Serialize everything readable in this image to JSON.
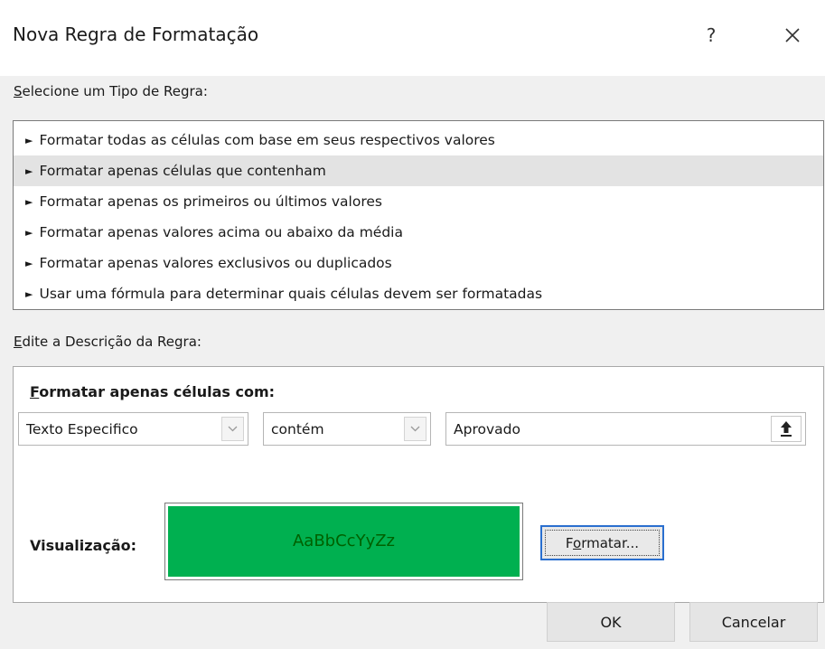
{
  "dialog": {
    "title": "Nova Regra de Formatação",
    "help_label": "?",
    "close_icon": "close-icon"
  },
  "rule_type": {
    "label_access_key": "S",
    "label_rest": "elecione um Tipo de Regra:",
    "selected_index": 1,
    "items": [
      "Formatar todas as células com base em seus respectivos valores",
      "Formatar apenas células que contenham",
      "Formatar apenas os primeiros ou últimos valores",
      "Formatar apenas valores acima ou abaixo da média",
      "Formatar apenas valores exclusivos ou duplicados",
      "Usar uma fórmula para determinar quais células devem ser formatadas"
    ]
  },
  "rule_description": {
    "label_access_key": "E",
    "label_rest": "dite a Descrição da Regra:",
    "heading_access_key": "F",
    "heading_rest": "ormatar apenas células com:",
    "condition_type": "Texto Especifico",
    "operator": "contém",
    "value": "Aprovado",
    "preview_label": "Visualização:",
    "preview_text": "AaBbCcYyZz",
    "format_button": {
      "before": "F",
      "access_key": "o",
      "after": "rmatar..."
    }
  },
  "buttons": {
    "ok": "OK",
    "cancel": "Cancelar"
  },
  "colors": {
    "preview_fill": "#00b050",
    "preview_text": "#006100",
    "focus_border": "#2a6fcf"
  }
}
